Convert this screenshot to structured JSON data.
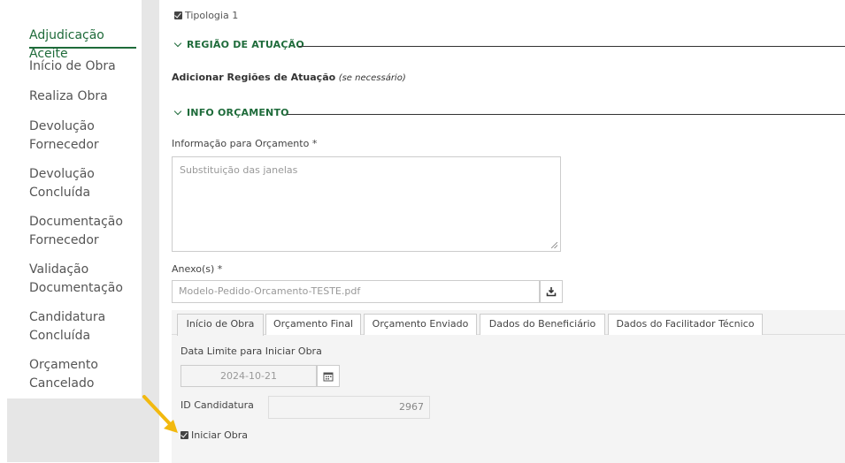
{
  "sidebar": {
    "items": [
      {
        "label": "Adjudicação Aceite",
        "active": true
      },
      {
        "label": "Início de Obra"
      },
      {
        "label": "Realiza Obra"
      },
      {
        "label": "Devolução",
        "label2": "Fornecedor"
      },
      {
        "label": "Devolução",
        "label2": "Concluída"
      },
      {
        "label": "Documentação",
        "label2": "Fornecedor"
      },
      {
        "label": "Validação",
        "label2": "Documentação"
      },
      {
        "label": "Candidatura",
        "label2": "Concluída"
      },
      {
        "label": "Orçamento",
        "label2": "Cancelado"
      }
    ]
  },
  "main": {
    "tipologia_label": "Tipologia 1",
    "regiao_section": "REGIÃO DE ATUAÇÃO",
    "adicionar_regioes": "Adicionar Regiões de Atuação",
    "adicionar_hint": "(se necessário)",
    "orcamento_section": "INFO ORÇAMENTO",
    "info_label": "Informação para Orçamento *",
    "info_value": "Substituição das janelas",
    "anexos_label": "Anexo(s) *",
    "anexo_file": "Modelo-Pedido-Orcamento-TESTE.pdf"
  },
  "tabs": [
    {
      "label": "Início de Obra",
      "active": true
    },
    {
      "label": "Orçamento Final"
    },
    {
      "label": "Orçamento Enviado"
    },
    {
      "label": "Dados do Beneficiário"
    },
    {
      "label": "Dados do Facilitador Técnico"
    }
  ],
  "inicio_obra": {
    "data_limite_label": "Data Limite para Iniciar Obra",
    "data_limite_value": "2024-10-21",
    "id_candidatura_label": "ID Candidatura",
    "id_candidatura_value": "2967",
    "iniciar_obra_label": "Iniciar Obra",
    "iniciar_obra_checked": true
  },
  "colors": {
    "accent": "#1e6b3a",
    "annotation_arrow": "#f2b90f"
  }
}
